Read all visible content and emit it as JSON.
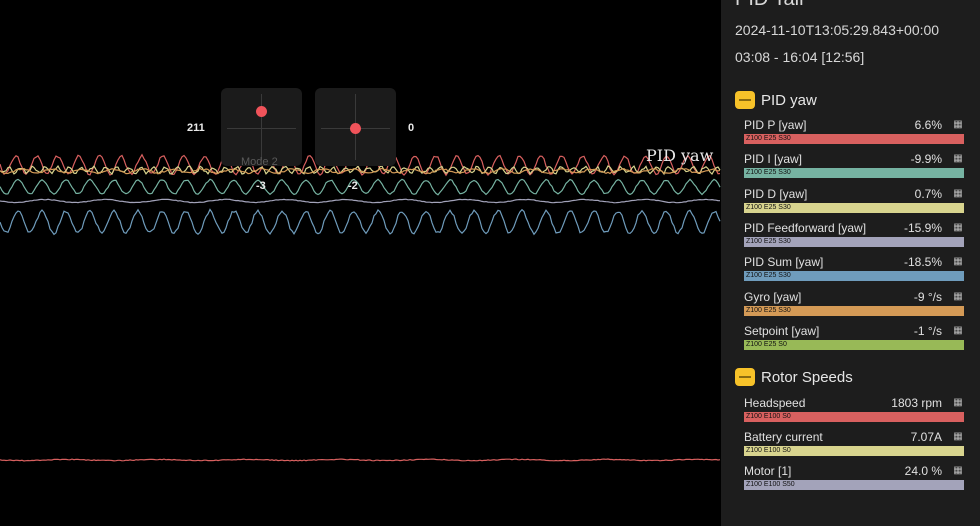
{
  "log": {
    "title": "PID Tail",
    "date": "2024-11-10T13:05:29.843+00:00",
    "range": "03:08 - 16:04 [12:56]"
  },
  "graph": {
    "title": "PID yaw",
    "sticks": [
      {
        "left_value": "211",
        "bottom_value": "-3",
        "mode": "Mode 2"
      },
      {
        "right_value": "0",
        "bottom_value": "-2"
      }
    ]
  },
  "groups": [
    {
      "name": "PID yaw",
      "fields": [
        {
          "name": "PID P [yaw]",
          "value": "6.6%",
          "scale": "Z100 E25 S30",
          "color": "#d8605f"
        },
        {
          "name": "PID I [yaw]",
          "value": "-9.9%",
          "scale": "Z100 E25 S30",
          "color": "#76b3a2"
        },
        {
          "name": "PID D [yaw]",
          "value": "0.7%",
          "scale": "Z100 E25 S30",
          "color": "#d8d48e"
        },
        {
          "name": "PID Feedforward [yaw]",
          "value": "-15.9%",
          "scale": "Z100 E25 S30",
          "color": "#a3a3ba"
        },
        {
          "name": "PID Sum [yaw]",
          "value": "-18.5%",
          "scale": "Z100 E25 S30",
          "color": "#6f9cbc"
        },
        {
          "name": "Gyro [yaw]",
          "value": "-9 °/s",
          "scale": "Z100 E25 S30",
          "color": "#d49a56"
        },
        {
          "name": "Setpoint [yaw]",
          "value": "-1 °/s",
          "scale": "Z100 E25 S0",
          "color": "#98b957"
        }
      ]
    },
    {
      "name": "Rotor Speeds",
      "fields": [
        {
          "name": "Headspeed",
          "value": "1803 rpm",
          "scale": "Z100 E100 S0",
          "color": "#d8605f"
        },
        {
          "name": "Battery current",
          "value": "7.07A",
          "scale": "Z100 E100 S0",
          "color": "#d8d48e"
        },
        {
          "name": "Motor [1]",
          "value": "24.0 %",
          "scale": "Z100 E100 S50",
          "color": "#a3a3ba"
        }
      ]
    }
  ]
}
